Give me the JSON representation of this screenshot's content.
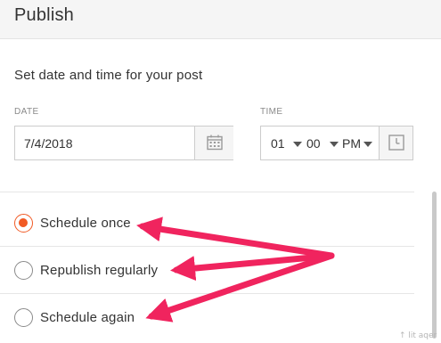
{
  "header": {
    "title": "Publish"
  },
  "schedule": {
    "section_title": "Set date and time for your post",
    "date": {
      "label": "DATE",
      "value": "7/4/2018",
      "button_icon": "calendar-icon"
    },
    "time": {
      "label": "TIME",
      "hour": "01",
      "minute": "00",
      "ampm": "PM",
      "button_icon": "clock-icon"
    }
  },
  "options": [
    {
      "label": "Schedule once",
      "selected": true
    },
    {
      "label": "Republish regularly",
      "selected": false
    },
    {
      "label": "Schedule again",
      "selected": false
    }
  ],
  "annotation": {
    "arrow_color": "#f0245e",
    "arrow_count": 3
  },
  "colors": {
    "accent": "#f15a24",
    "header_bg": "#f5f5f5",
    "border": "#cccccc"
  },
  "watermark": {
    "text": "↑ lit  aqer"
  }
}
